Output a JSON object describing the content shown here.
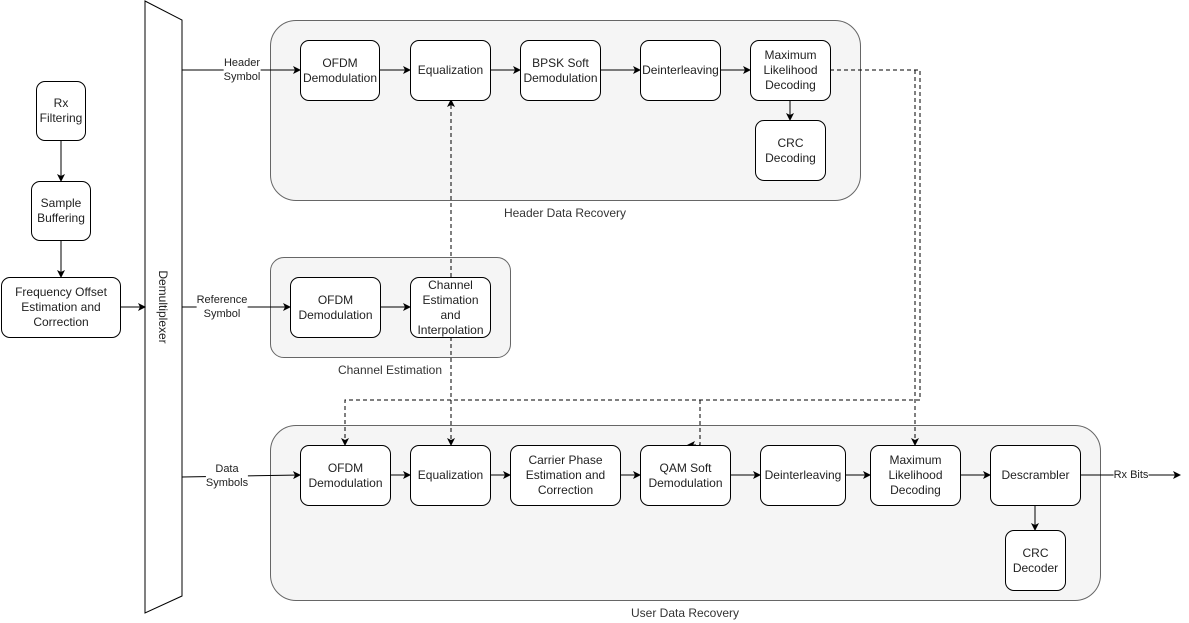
{
  "demultiplexer": "Demultiplexer",
  "pre": {
    "rx_filtering": "Rx\nFiltering",
    "sample_buffering": "Sample\nBuffering",
    "freq_offset": "Frequency Offset\nEstimation and\nCorrection"
  },
  "header": {
    "label": "Header Data Recovery",
    "input": "Header\nSymbol",
    "blocks": [
      "OFDM\nDemodulation",
      "Equalization",
      "BPSK Soft\nDemodulation",
      "Deinterleaving",
      "Maximum\nLikelihood\nDecoding",
      "CRC\nDecoding"
    ]
  },
  "channel": {
    "label": "Channel Estimation",
    "input": "Reference\nSymbol",
    "blocks": [
      "OFDM\nDemodulation",
      "Channel\nEstimation\nand\nInterpolation"
    ]
  },
  "user": {
    "label": "User Data Recovery",
    "input": "Data\nSymbols",
    "output": "Rx Bits",
    "blocks": [
      "OFDM\nDemodulation",
      "Equalization",
      "Carrier Phase\nEstimation and\nCorrection",
      "QAM Soft\nDemodulation",
      "Deinterleaving",
      "Maximum\nLikelihood\nDecoding",
      "Descrambler",
      "CRC\nDecoder"
    ]
  }
}
